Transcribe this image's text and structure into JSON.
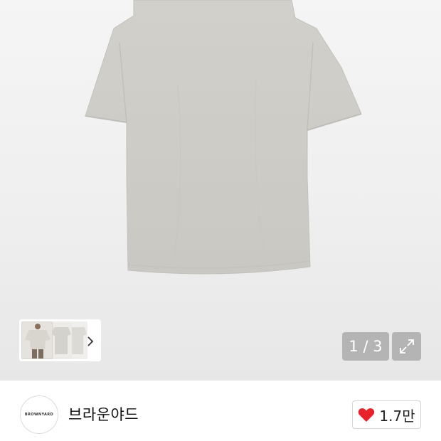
{
  "gallery": {
    "image": "t-shirt-product-photo",
    "thumbnails": [
      "model-wearing-shirt",
      "shirt-flat",
      "shirt-back"
    ],
    "counter": "1 / 3",
    "next_icon": "chevron-right-icon",
    "expand_icon": "expand-icon"
  },
  "brand": {
    "logo_text": "BROWNYARD",
    "name": "브라운야드"
  },
  "like": {
    "icon": "heart-icon",
    "color": "#e8222b",
    "count": "1.7만"
  },
  "colors": {
    "shirt": "#cfcdc7",
    "overlay": "#b4b4b4"
  }
}
